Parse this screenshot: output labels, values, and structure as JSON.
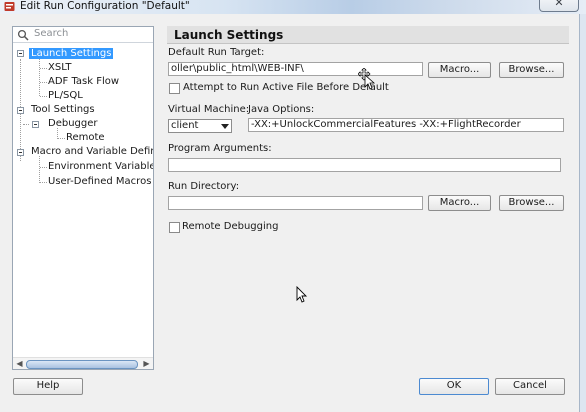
{
  "window": {
    "title": "Edit Run Configuration \"Default\"",
    "close_glyph": "✕"
  },
  "nav": {
    "search_placeholder": "Search",
    "items": [
      {
        "label": "Launch Settings",
        "selected": true
      },
      {
        "label": "XSLT"
      },
      {
        "label": "ADF Task Flow"
      },
      {
        "label": "PL/SQL"
      },
      {
        "label": "Tool Settings"
      },
      {
        "label": "Debugger"
      },
      {
        "label": "Remote"
      },
      {
        "label": "Macro and Variable Definitions"
      },
      {
        "label": "Environment Variables"
      },
      {
        "label": "User-Defined Macros"
      }
    ],
    "scroll_left": "◀",
    "scroll_right": "▶"
  },
  "main": {
    "heading": "Launch Settings",
    "default_run_target_label": "Default Run Target:",
    "default_run_target_value": "oller\\public_html\\WEB-INF\\",
    "macro_label": "Macro...",
    "browse_label": "Browse...",
    "attempt_label": "Attempt to Run Active File Before Default",
    "virtual_machine_label": "Virtual Machine:",
    "virtual_machine_value": "client",
    "java_options_label": "Java Options:",
    "java_options_value": "-XX:+UnlockCommercialFeatures -XX:+FlightRecorder",
    "program_arguments_label": "Program Arguments:",
    "program_arguments_value": "",
    "run_directory_label": "Run Directory:",
    "run_directory_value": "",
    "macro_label_2": "Macro...",
    "browse_label_2": "Browse...",
    "remote_debugging_label": "Remote Debugging"
  },
  "footer": {
    "help_label": "Help",
    "ok_label": "OK",
    "cancel_label": "Cancel"
  },
  "colors": {
    "selection": "#3399ff",
    "dialog_bg": "#f0f0f0",
    "header_bg": "#e1e1e1"
  }
}
